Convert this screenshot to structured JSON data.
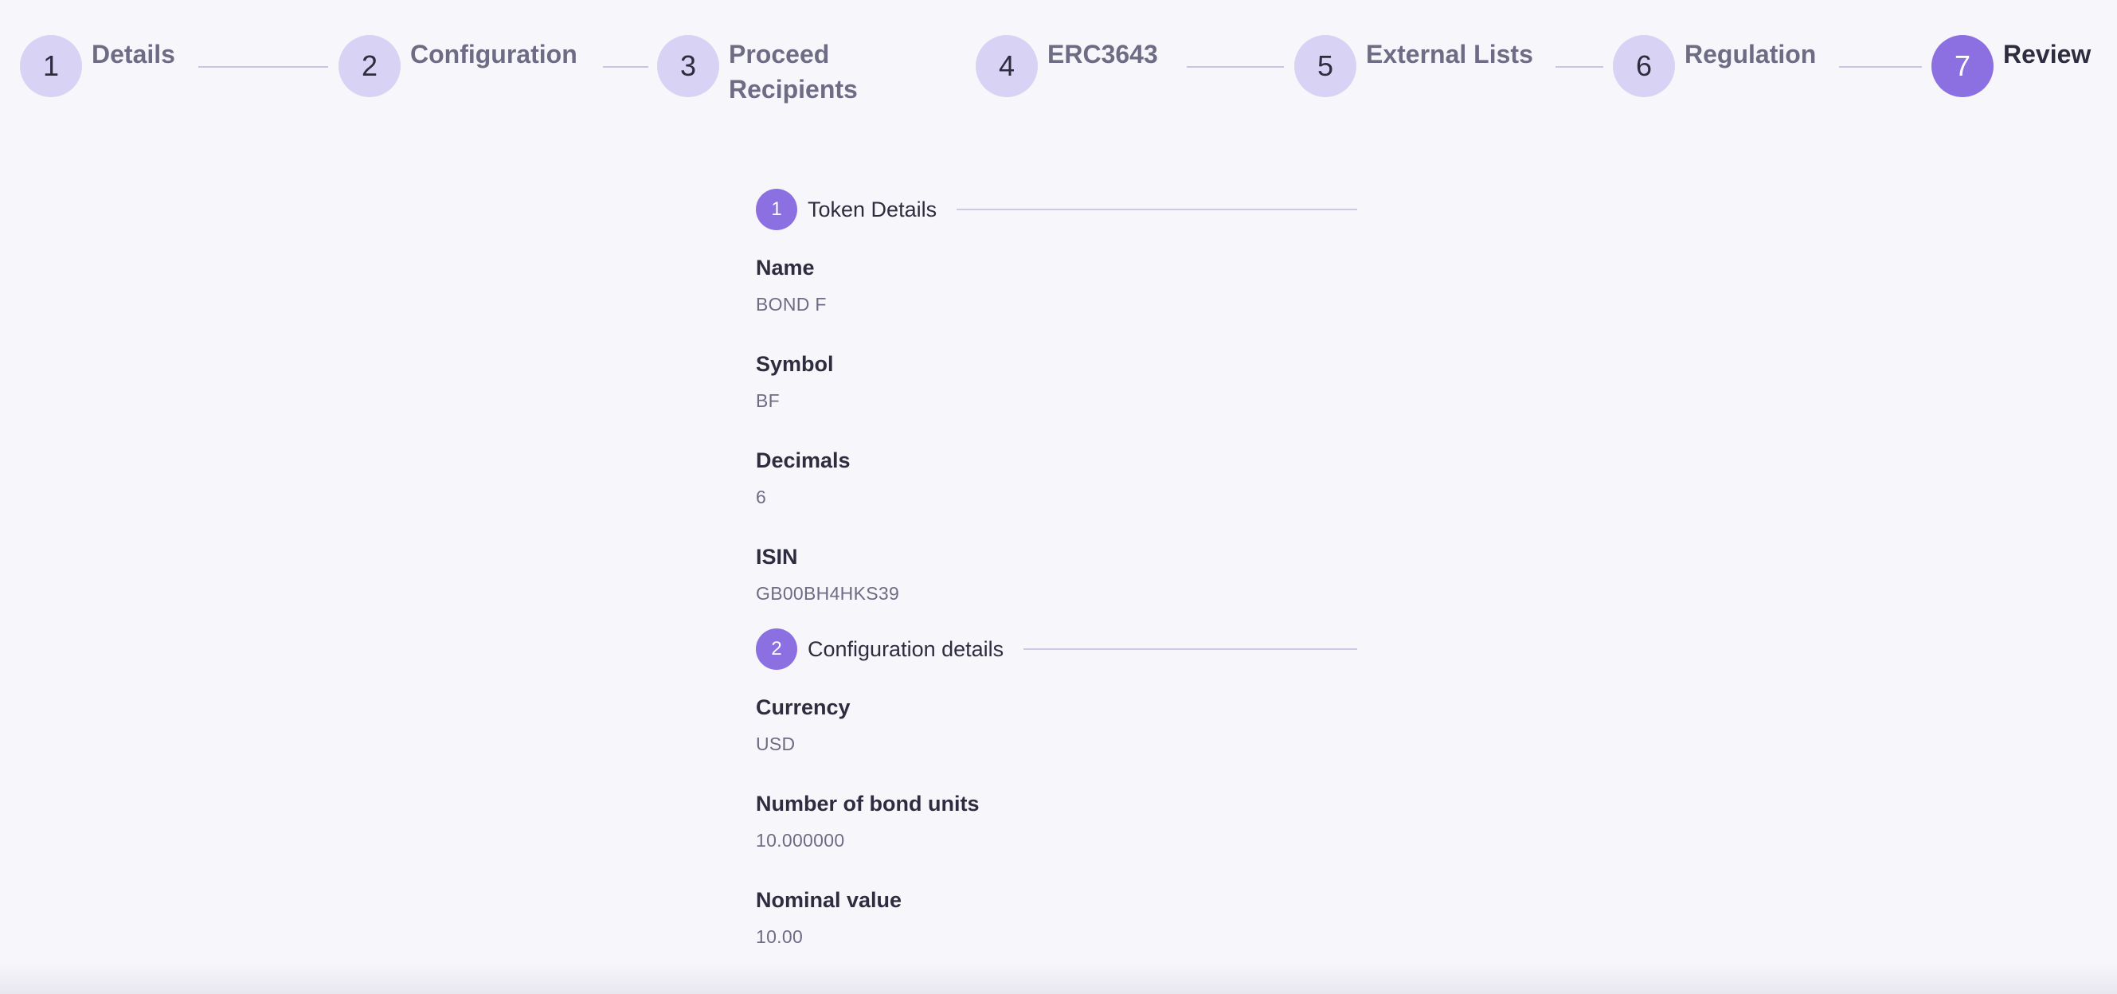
{
  "stepper": {
    "steps": [
      {
        "number": "1",
        "label": "Details"
      },
      {
        "number": "2",
        "label": "Configuration"
      },
      {
        "number": "3",
        "label": "Proceed Recipients"
      },
      {
        "number": "4",
        "label": "ERC3643"
      },
      {
        "number": "5",
        "label": "External Lists"
      },
      {
        "number": "6",
        "label": "Regulation"
      },
      {
        "number": "7",
        "label": "Review"
      }
    ],
    "active_step": "7"
  },
  "review": {
    "sections": [
      {
        "number": "1",
        "title": "Token Details",
        "fields": [
          {
            "label": "Name",
            "value": "BOND F"
          },
          {
            "label": "Symbol",
            "value": "BF"
          },
          {
            "label": "Decimals",
            "value": "6"
          },
          {
            "label": "ISIN",
            "value": "GB00BH4HKS39"
          }
        ]
      },
      {
        "number": "2",
        "title": "Configuration details",
        "fields": [
          {
            "label": "Currency",
            "value": "USD"
          },
          {
            "label": "Number of bond units",
            "value": "10.000000"
          },
          {
            "label": "Nominal value",
            "value": "10.00"
          }
        ]
      }
    ]
  },
  "colors": {
    "background": "#f7f7fb",
    "accent": "#8c70e2",
    "inactive_step": "#d8d2f4",
    "text_primary": "#2e2c3f",
    "text_secondary": "#6e6b85"
  }
}
